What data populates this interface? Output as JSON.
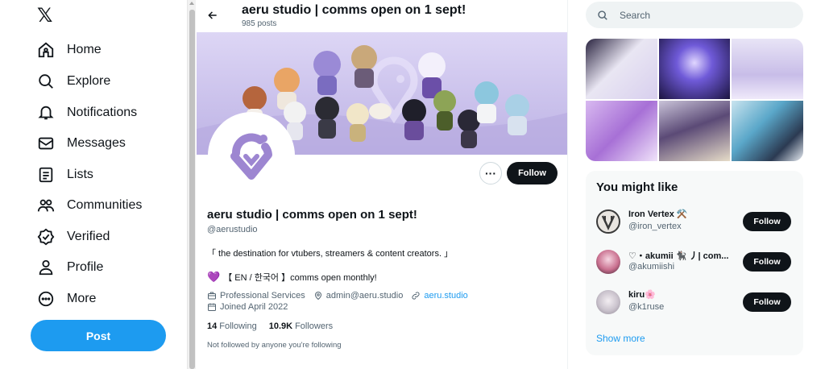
{
  "nav": {
    "logo": "𝕏",
    "items": [
      {
        "label": "Home",
        "icon": "home-icon"
      },
      {
        "label": "Explore",
        "icon": "search-icon"
      },
      {
        "label": "Notifications",
        "icon": "bell-icon"
      },
      {
        "label": "Messages",
        "icon": "mail-icon"
      },
      {
        "label": "Lists",
        "icon": "list-icon"
      },
      {
        "label": "Communities",
        "icon": "people-icon"
      },
      {
        "label": "Verified",
        "icon": "verified-icon"
      },
      {
        "label": "Profile",
        "icon": "person-icon"
      },
      {
        "label": "More",
        "icon": "more-circle-icon"
      }
    ],
    "post_label": "Post"
  },
  "header": {
    "title": "aeru studio | comms open on 1 sept!",
    "post_count": "985 posts"
  },
  "profile": {
    "name": "aeru studio | comms open on 1 sept!",
    "handle": "@aerustudio",
    "bio_line1": "「 the destination for vtubers, streamers & content creators. 」",
    "bio_heart": "💜",
    "bio_line2": "【 EN / 한국어 】comms open monthly!",
    "category": "Professional Services",
    "email": "admin@aeru.studio",
    "website": "aeru.studio",
    "joined": "Joined April 2022",
    "following_count": "14",
    "following_label": "Following",
    "followers_count": "10.9K",
    "followers_label": "Followers",
    "not_followed": "Not followed by anyone you're following",
    "follow_label": "Follow",
    "more_label": "···"
  },
  "search": {
    "placeholder": "Search"
  },
  "who_to_follow": {
    "title": "You might like",
    "items": [
      {
        "name": "Iron Vertex ⚒️",
        "handle": "@iron_vertex",
        "button": "Follow"
      },
      {
        "name": "♡・akumii 🐈‍⬛ ⼃| com...",
        "handle": "@akumiishi",
        "button": "Follow"
      },
      {
        "name": "kiru🌸",
        "handle": "@k1ruse",
        "button": "Follow"
      }
    ],
    "show_more": "Show more"
  },
  "colors": {
    "accent": "#1d9bf0",
    "brand_purple": "#9d86d1",
    "dark_button": "#0f1419"
  }
}
